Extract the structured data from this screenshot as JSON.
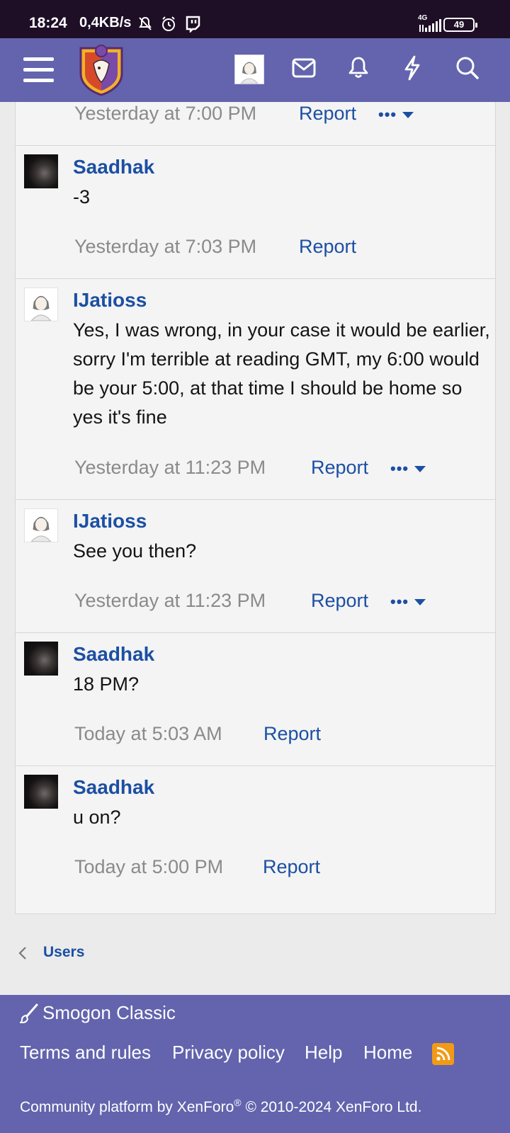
{
  "status_bar": {
    "time": "18:24",
    "speed": "0,4KB/s",
    "network": "4G",
    "battery": "49"
  },
  "nav": {
    "icons": [
      "menu-icon",
      "site-logo",
      "user-avatar",
      "inbox-icon",
      "bell-icon",
      "whats-new-icon",
      "search-icon"
    ]
  },
  "messages": [
    {
      "author": "",
      "text": "",
      "time": "Yesterday at 7:00 PM",
      "report": "Report",
      "more": "•••"
    },
    {
      "author": "Saadhak",
      "text": "-3",
      "time": "Yesterday at 7:03 PM",
      "report": "Report"
    },
    {
      "author": "IJatioss",
      "text": "Yes, I was wrong, in your case it would be earlier, sorry I'm terrible at reading GMT, my 6:00 would be your 5:00, at that time I should be home so yes it's fine",
      "time": "Yesterday at 11:23 PM",
      "report": "Report",
      "more": "•••"
    },
    {
      "author": "IJatioss",
      "text": "See you then?",
      "time": "Yesterday at 11:23 PM",
      "report": "Report",
      "more": "•••"
    },
    {
      "author": "Saadhak",
      "text": "18 PM?",
      "time": "Today at 5:03 AM",
      "report": "Report"
    },
    {
      "author": "Saadhak",
      "text": "u on?",
      "time": "Today at 5:00 PM",
      "report": "Report"
    }
  ],
  "breadcrumb": {
    "label": "Users"
  },
  "footer": {
    "style_chooser": "Smogon Classic",
    "links": [
      "Terms and rules",
      "Privacy policy",
      "Help",
      "Home"
    ],
    "copyright_prefix": "Community platform by XenForo",
    "copyright_reg": "®",
    "copyright_suffix": " © 2010-2024 XenForo Ltd."
  },
  "colors": {
    "nav_bg": "#6364ad",
    "status_bg": "#1e0f26",
    "link": "#1c4fa3",
    "rss": "#f29a16"
  }
}
